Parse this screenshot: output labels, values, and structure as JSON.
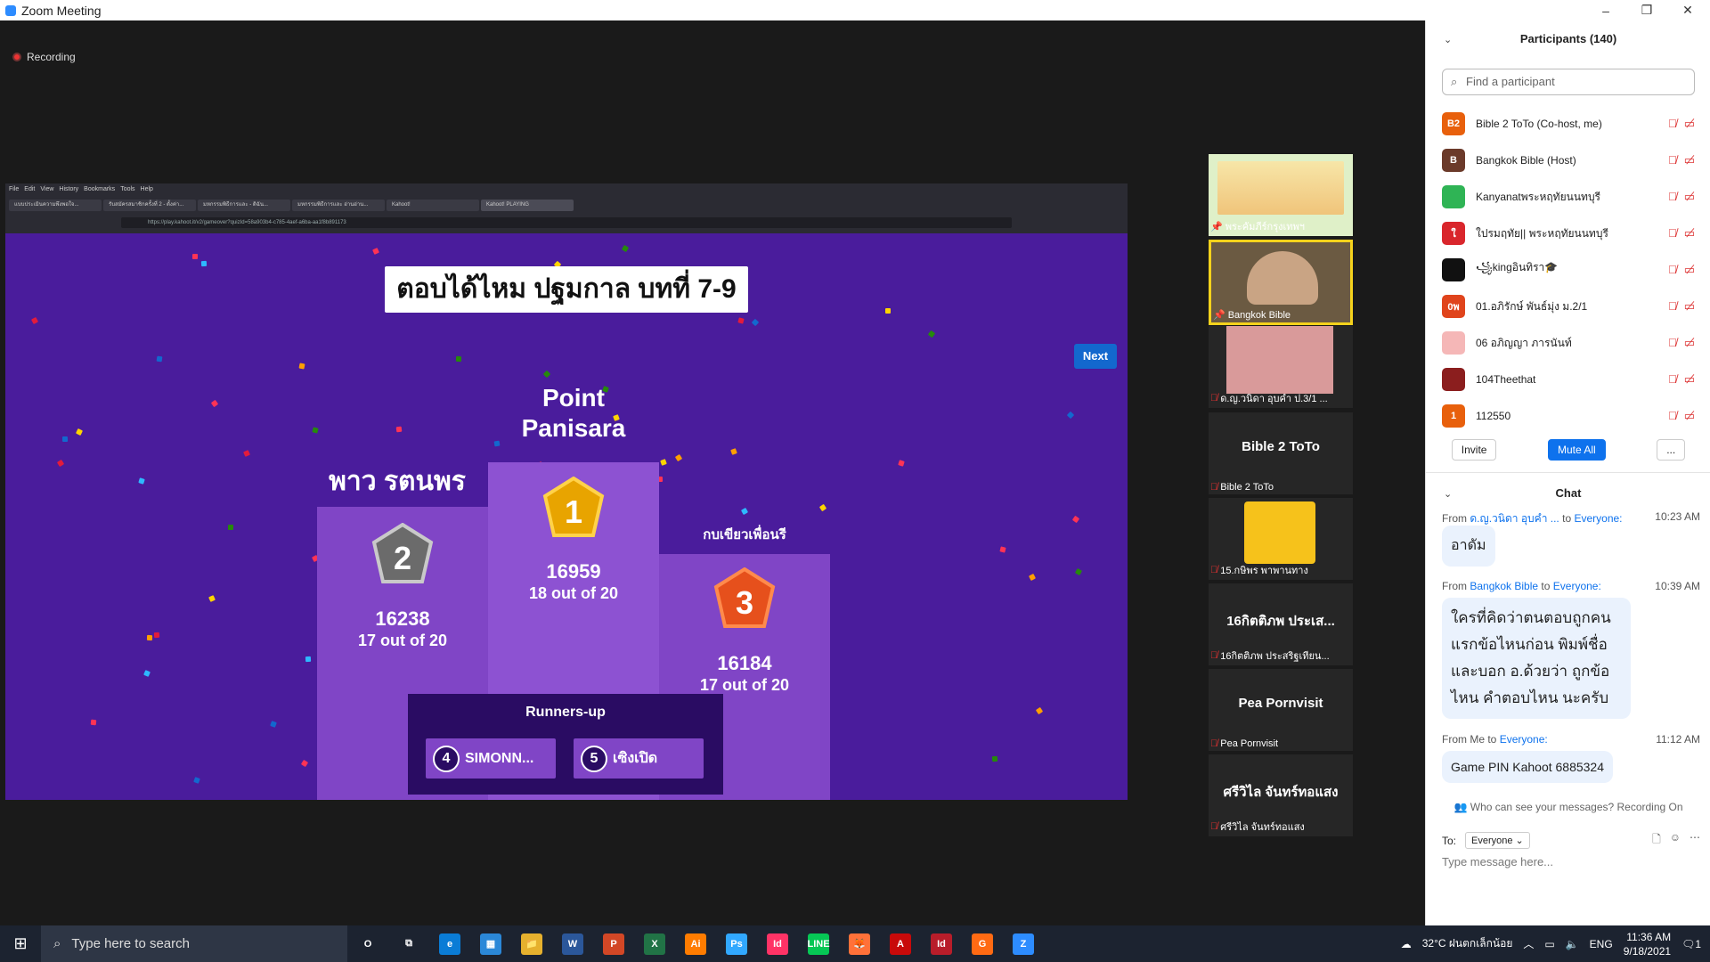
{
  "window": {
    "title": "Zoom Meeting",
    "minimize": "–",
    "restore": "❐",
    "close": "✕"
  },
  "recording": {
    "label": "Recording"
  },
  "browser": {
    "menu": [
      "File",
      "Edit",
      "View",
      "History",
      "Bookmarks",
      "Tools",
      "Help"
    ],
    "tabs": [
      "แบบประเมินความพึงพอใจ...",
      "รับสมัครสมาชิกครั้งที่ 2 - ตั้งค่า...",
      "มหกรรมพิธีการและ - ดิฉัน...",
      "มหกรรมพิธีการและ อ่านอ่าน...",
      "Kahoot!",
      "Kahoot! PLAYING"
    ],
    "url": "https://play.kahoot.it/v2/gameover?quizId=58a903b4-c785-4aef-a6ba-aa1f8b891173"
  },
  "game": {
    "title": "ตอบได้ไหม ปฐมกาล บทที่ 7-9",
    "next_label": "Next",
    "first": {
      "name_line1": "Point",
      "name_line2": "Panisara",
      "rank": "1",
      "score": "16959",
      "correct": "18 out of 20"
    },
    "second": {
      "name": "พาว รตนพร",
      "rank": "2",
      "score": "16238",
      "correct": "17 out of 20"
    },
    "third": {
      "name": "กบเขียวเพื่อนรี",
      "rank": "3",
      "score": "16184",
      "correct": "17 out of 20"
    },
    "runners_title": "Runners-up",
    "runners": [
      {
        "rank": "4",
        "name": "SIMONN..."
      },
      {
        "rank": "5",
        "name": "เซิงเปิด"
      }
    ],
    "colors": {
      "bg": "#4a1c9c",
      "podium": "#8045c6",
      "gold": "#e8a400",
      "silver": "#6b6b6b",
      "bronze": "#e6501c"
    }
  },
  "videos": [
    {
      "label": "พระคัมภีร์กรุงเทพฯ",
      "big": ""
    },
    {
      "label": "Bangkok Bible",
      "big": ""
    },
    {
      "label": "ด.ญ.วนิดา อุบคำ ป.3/1 ...",
      "big": ""
    },
    {
      "label": "Bible 2 ToTo",
      "big": "Bible 2 ToTo"
    },
    {
      "label": "15.กษิพร พาพานทาง",
      "big": ""
    },
    {
      "label": "16กิตติภพ ประสริฐเทียน...",
      "big": "16กิตติภพ ประเส..."
    },
    {
      "label": "Pea Pornvisit",
      "big": "Pea Pornvisit"
    },
    {
      "label": "ศรีวิไล จันทร์ทอแสง",
      "big": "ศรีวิไล จันทร์ทอแสง"
    }
  ],
  "participants": {
    "title": "Participants (140)",
    "search_placeholder": "Find a participant",
    "list": [
      {
        "initials": "B2",
        "color": "#e8600c",
        "name": "Bible 2 ToTo (Co-host, me)"
      },
      {
        "initials": "B",
        "color": "#6b3a2a",
        "name": "Bangkok Bible (Host)"
      },
      {
        "initials": "",
        "color": "#2fb455",
        "name": "Kanyanatพระหฤทัยนนทบุรี"
      },
      {
        "initials": "ใ",
        "color": "#d9262c",
        "name": "ใปรมฤทัย|| พระหฤทัยนนทบุรี"
      },
      {
        "initials": "",
        "color": "#111111",
        "name": "꧁kingอินทิรา🎓"
      },
      {
        "initials": "0พ",
        "color": "#e0441c",
        "name": "01.อภิรักษ์ พันธ์มุ่ง ม.2/1"
      },
      {
        "initials": "",
        "color": "#f5b7b7",
        "name": "06 อภิญญา ภารนันท์"
      },
      {
        "initials": "",
        "color": "#8b1e1e",
        "name": "104Theethat"
      },
      {
        "initials": "1",
        "color": "#e8600c",
        "name": "112550"
      }
    ],
    "invite": "Invite",
    "mute_all": "Mute All",
    "more": "..."
  },
  "chat": {
    "title": "Chat",
    "messages": [
      {
        "from": "From",
        "sender": "ด.ญ.วนิดา อุบคำ ...",
        "to_word": "to",
        "to": "Everyone:",
        "time": "10:23 AM",
        "text": "อาดัม"
      },
      {
        "from": "From",
        "sender": "Bangkok Bible",
        "to_word": "to",
        "to": "Everyone:",
        "time": "10:39 AM",
        "text": "ใครที่คิดว่าตนตอบถูกคนแรกข้อไหนก่อน พิมพ์ชื่อและบอก อ.ด้วยว่า ถูกข้อไหน คำตอบไหน นะครับ"
      },
      {
        "from": "From Me",
        "sender": "",
        "to_word": "to",
        "to": "Everyone:",
        "time": "11:12 AM",
        "text": "Game PIN Kahoot 6885324"
      }
    ],
    "notice": "Who can see your messages? Recording On",
    "to_label": "To:",
    "to_value": "Everyone",
    "placeholder": "Type message here..."
  },
  "taskbar": {
    "search": "Type here to search",
    "apps": [
      "O",
      "⧉",
      "e",
      "▦",
      "📁",
      "W",
      "P",
      "X",
      "Ai",
      "Ps",
      "Id",
      "LINE",
      "🦊",
      "A",
      "Id",
      "G",
      "Z"
    ],
    "weather": "32°C ฝนตกเล็กน้อย",
    "lang": "ENG",
    "time": "11:36 AM",
    "date": "9/18/2021",
    "notif": "1"
  }
}
